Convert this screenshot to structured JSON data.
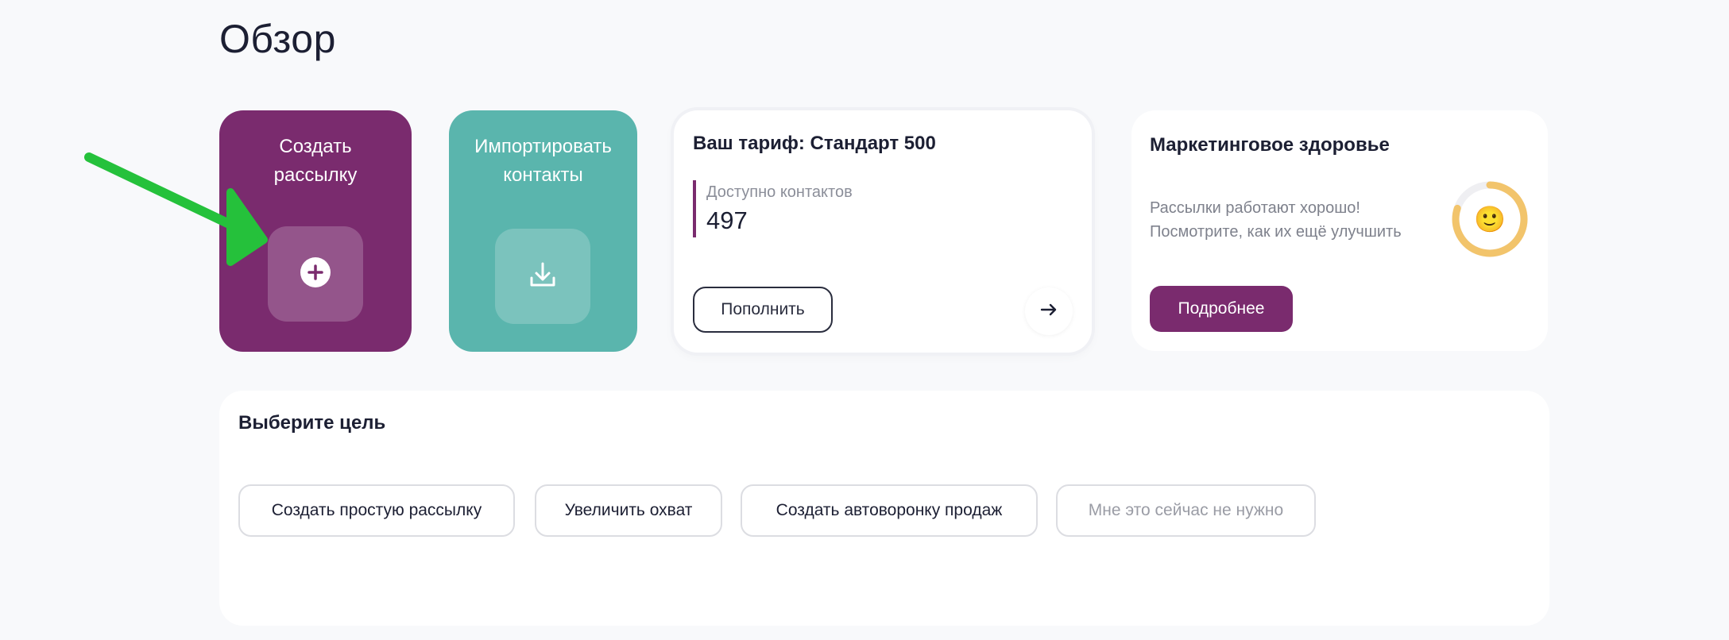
{
  "page": {
    "title": "Обзор"
  },
  "tiles": {
    "create": {
      "label": "Создать\nрассылку",
      "icon": "plus-circle-icon",
      "color": "#7a2b6e"
    },
    "import": {
      "label": "Импортировать\nконтакты",
      "icon": "download-icon",
      "color": "#5ab5ad"
    }
  },
  "tariff": {
    "title": "Ваш тариф: Стандарт 500",
    "contacts_label": "Доступно контактов",
    "contacts_value": "497",
    "topup_label": "Пополнить",
    "arrow_icon": "arrow-right-icon"
  },
  "health": {
    "title": "Маркетинговое здоровье",
    "text_line1": "Рассылки работают хорошо!",
    "text_line2": "Посмотрите, как их ещё улучшить",
    "emoji": "🙂",
    "progress": 0.8,
    "ring_color": "#f2c46b",
    "details_label": "Подробнее"
  },
  "goal": {
    "title": "Выберите цель",
    "options": [
      "Создать простую рассылку",
      "Увеличить охват",
      "Создать автоворонку продаж",
      "Мне это сейчас не нужно"
    ]
  },
  "annotation": {
    "color": "#25c13b"
  }
}
